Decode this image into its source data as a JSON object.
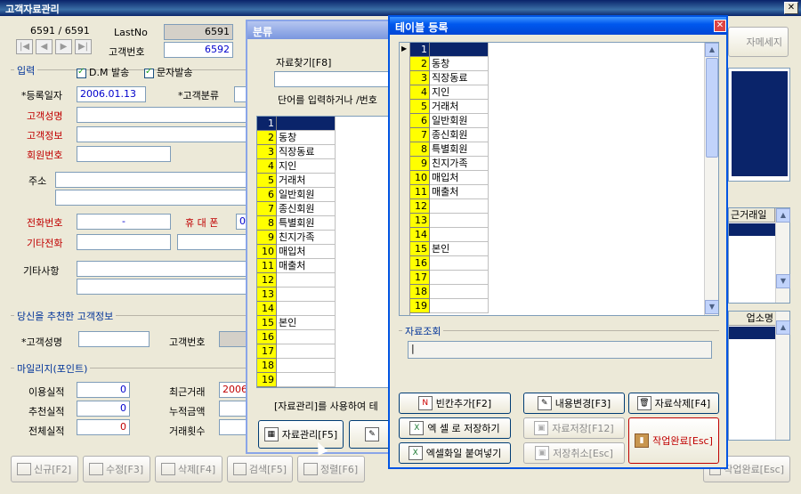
{
  "main": {
    "title": "고객자료관리",
    "record_counter": "6591 / 6591",
    "lastno_label": "LastNo",
    "lastno_value": "6591",
    "customer_no_label": "고객번호",
    "customer_no_value": "6592",
    "input_group": "입력",
    "dm_label": "D.M 발송",
    "sms_label": "문자발송",
    "reg_date_label": "*등록일자",
    "reg_date_value": "2006.01.13",
    "category_label": "*고객분류",
    "name_label": "고객성명",
    "info_label": "고객정보",
    "member_no_label": "회원번호",
    "address_label": "주소",
    "phone_label": "전화번호",
    "phone_value": "-",
    "mobile_label": "휴 대 폰",
    "mobile_value": "0",
    "other_phone_label": "기타전화",
    "notes_label": "기타사항",
    "referrer_group": "당신을 추천한 고객정보",
    "ref_name_label": "*고객성명",
    "ref_no_label": "고객번호",
    "mileage_group": "마일리지(포인트)",
    "usage_label": "이용실적",
    "usage_value": "0",
    "recommend_label": "추천실적",
    "recommend_value": "0",
    "total_label": "전체실적",
    "total_value": "0",
    "recent_label": "최근거래",
    "recent_value": "2006",
    "accum_label": "누적금액",
    "tx_count_label": "거래횟수",
    "sms_button": "자메세지",
    "right_list_header": "근거래일",
    "right_list2_header": "업소명"
  },
  "bottom_buttons": [
    {
      "label": "신규[F2]"
    },
    {
      "label": "수정[F3]"
    },
    {
      "label": "삭제[F4]"
    },
    {
      "label": "검색[F5]"
    },
    {
      "label": "정렬[F6]"
    },
    {
      "label": "작업완료[Esc]"
    }
  ],
  "category_window": {
    "title": "분류",
    "search_label": "자료찾기[F8]",
    "hint": "단어를 입력하거나 /번호",
    "footer_text": "[자료관리]를 사용하여 테",
    "manage_button": "자료관리[F5]",
    "items": [
      "",
      "동창",
      "직장동료",
      "지인",
      "거래처",
      "일반회원",
      "종신회원",
      "특별회원",
      "친지가족",
      "매입처",
      "매출처",
      "",
      "",
      "",
      "본인",
      "",
      "",
      "",
      ""
    ]
  },
  "table_window": {
    "title": "테이블 등록",
    "lookup_label": "자료조회",
    "items": [
      "",
      "동창",
      "직장동료",
      "지인",
      "거래처",
      "일반회원",
      "종신회원",
      "특별회원",
      "친지가족",
      "매입처",
      "매출처",
      "",
      "",
      "",
      "본인",
      "",
      "",
      "",
      ""
    ],
    "buttons": {
      "add_blank": "빈칸추가[F2]",
      "edit_content": "내용변경[F3]",
      "delete_data": "자료삭제[F4]",
      "save_excel": "엑 셀 로 저장하기",
      "save_data": "자료저장[F12]",
      "done": "작업완료[Esc]",
      "paste_excel": "엑셀화일 붙여넣기",
      "cancel_save": "저장취소[Esc]"
    }
  }
}
